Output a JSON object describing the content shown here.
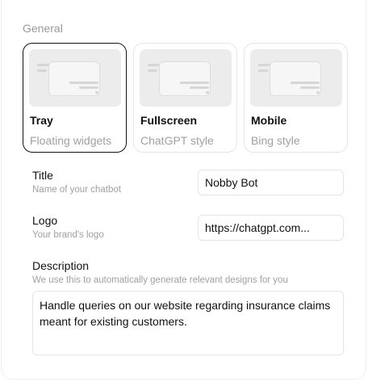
{
  "general": {
    "section_label": "General",
    "layouts": [
      {
        "name": "Tray",
        "subtitle": "Floating widgets",
        "selected": true
      },
      {
        "name": "Fullscreen",
        "subtitle": "ChatGPT style",
        "selected": false
      },
      {
        "name": "Mobile",
        "subtitle": "Bing style",
        "selected": false
      }
    ]
  },
  "title_field": {
    "label": "Title",
    "hint": "Name of your chatbot",
    "value": "Nobby Bot"
  },
  "logo_field": {
    "label": "Logo",
    "hint": "Your brand's logo",
    "value": "https://chatgpt.com..."
  },
  "description_field": {
    "label": "Description",
    "hint": "We use this to automatically generate relevant designs for you",
    "value": "Handle queries on our website regarding insurance claims meant for existing customers."
  },
  "colors": {
    "selected_border": "#111111",
    "muted_text": "#a0a0a0",
    "border": "#e5e5e5"
  }
}
